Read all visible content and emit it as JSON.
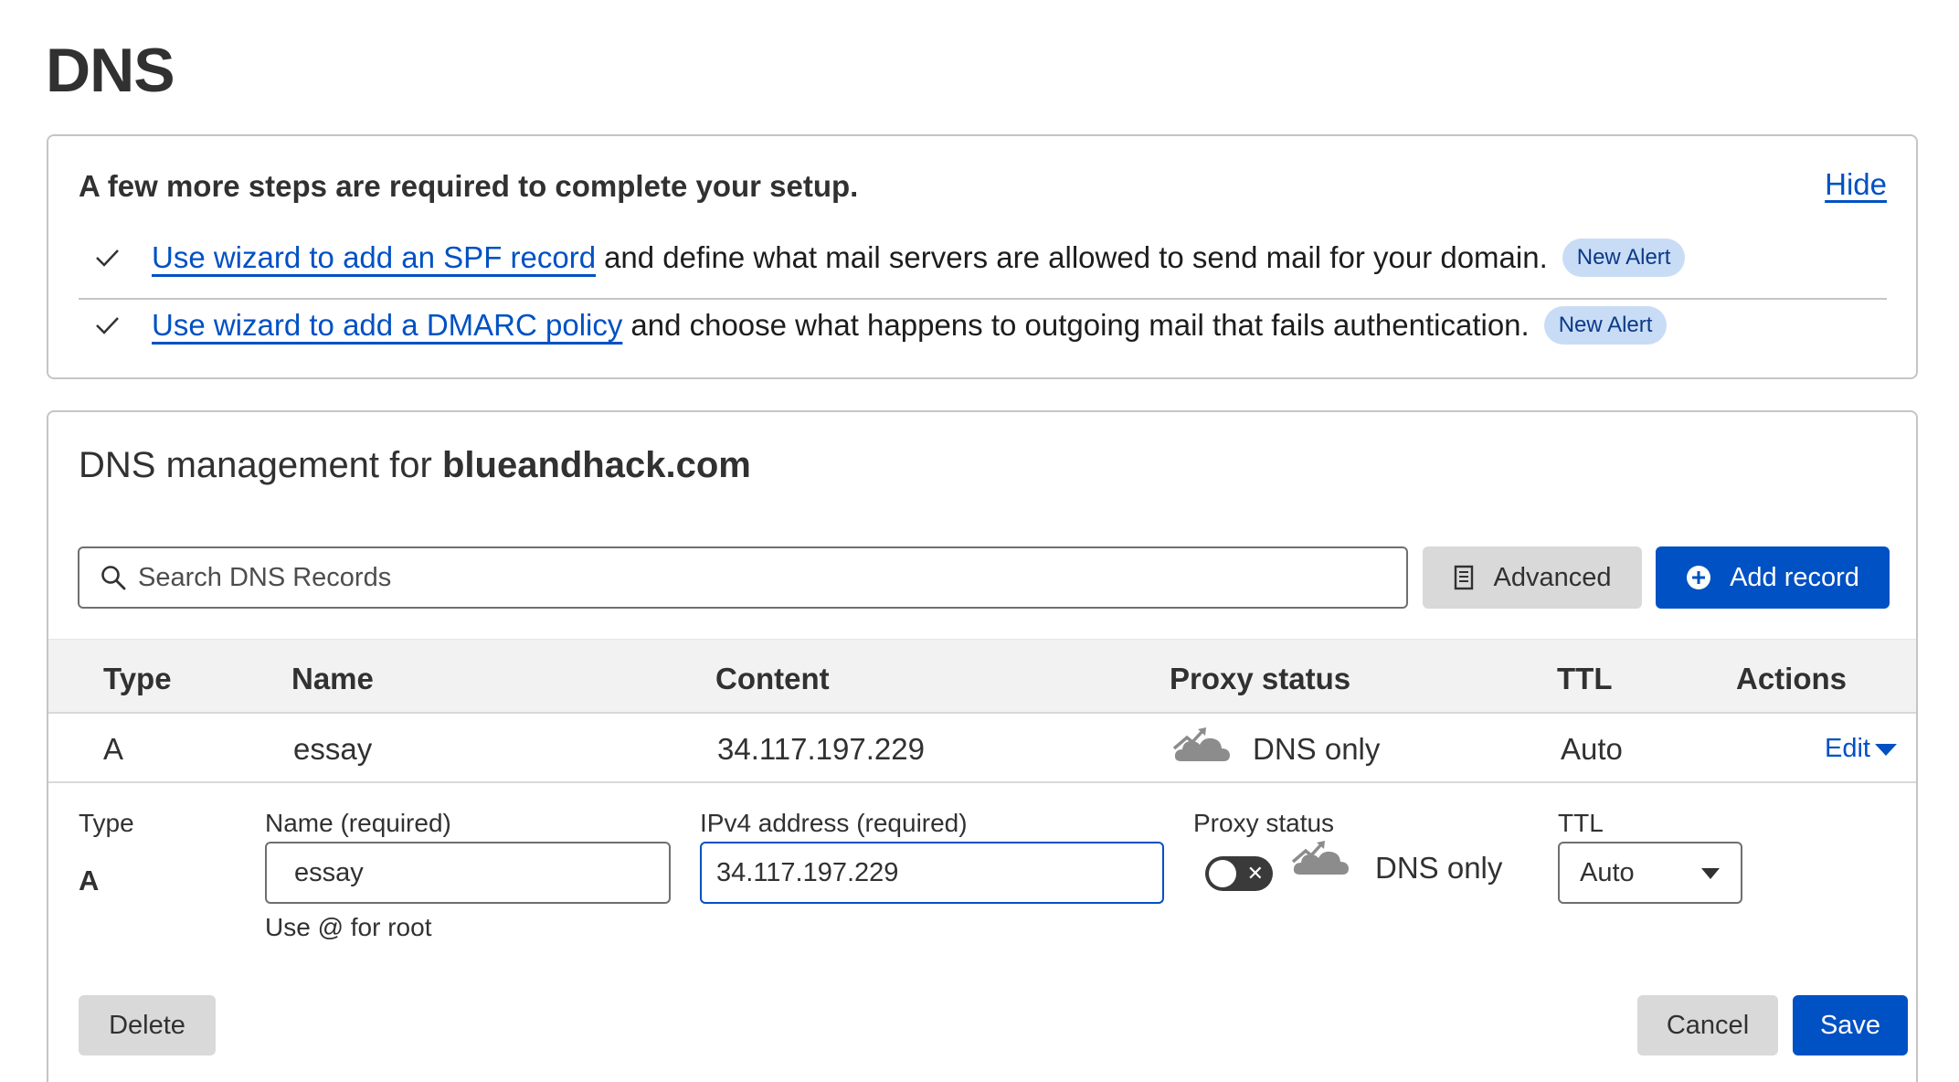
{
  "page": {
    "title": "DNS"
  },
  "setup": {
    "heading": "A few more steps are required to complete your setup.",
    "hide_label": "Hide",
    "items": [
      {
        "link": "Use wizard to add an SPF record",
        "text": "and define what mail servers are allowed to send mail for your domain.",
        "badge": "New Alert"
      },
      {
        "link": "Use wizard to add a DMARC policy",
        "text": "and choose what happens to outgoing mail that fails authentication.",
        "badge": "New Alert"
      }
    ]
  },
  "management": {
    "title_prefix": "DNS management for",
    "domain": "blueandhack.com",
    "search_placeholder": "Search DNS Records",
    "advanced_label": "Advanced",
    "add_record_label": "Add record"
  },
  "table": {
    "headers": {
      "type": "Type",
      "name": "Name",
      "content": "Content",
      "proxy": "Proxy status",
      "ttl": "TTL",
      "actions": "Actions"
    },
    "row": {
      "type": "A",
      "name": "essay",
      "content": "34.117.197.229",
      "proxy": "DNS only",
      "ttl": "Auto",
      "action": "Edit"
    }
  },
  "edit_form": {
    "type_label": "Type",
    "type_value": "A",
    "name_label": "Name (required)",
    "name_value": "essay",
    "name_hint": "Use @ for root",
    "ipv4_label": "IPv4 address (required)",
    "ipv4_value": "34.117.197.229",
    "proxy_label": "Proxy status",
    "proxy_value": "DNS only",
    "proxy_enabled": false,
    "ttl_label": "TTL",
    "ttl_value": "Auto",
    "delete_label": "Delete",
    "cancel_label": "Cancel",
    "save_label": "Save"
  },
  "colors": {
    "accent": "#0051c3",
    "badge_bg": "#c9dcf6",
    "button_gray": "#d9d9d9"
  },
  "icons": [
    "check-icon",
    "search-icon",
    "document-icon",
    "plus-circle-icon",
    "cloud-icon",
    "caret-down-icon"
  ]
}
